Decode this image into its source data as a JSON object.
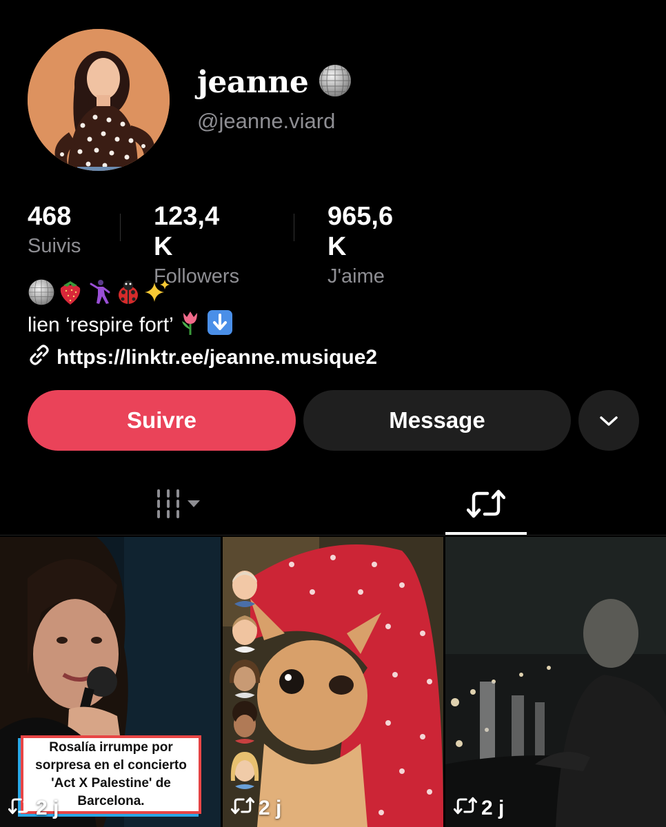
{
  "profile": {
    "display_name": "jeanne",
    "name_emoji": "disco-ball-icon",
    "handle": "@jeanne.viard"
  },
  "stats": [
    {
      "value": "468",
      "label": "Suivis"
    },
    {
      "value": "123,4 K",
      "label": "Followers"
    },
    {
      "value": "965,6 K",
      "label": "J'aime"
    }
  ],
  "bio": {
    "emojis": [
      "disco-ball-icon",
      "strawberry-icon",
      "dancer-icon",
      "ladybug-icon",
      "sparkles-icon"
    ],
    "line": "lien ‘respire fort’",
    "line_emojis": [
      "tulip-icon",
      "down-arrow-icon"
    ],
    "link": "https://linktr.ee/jeanne.musique2"
  },
  "actions": {
    "follow": "Suivre",
    "message": "Message",
    "more": "chevron-down-icon"
  },
  "tabs": [
    {
      "name": "videos",
      "icon": "grid-icon",
      "selected": false
    },
    {
      "name": "reposts",
      "icon": "repost-icon",
      "selected": true
    }
  ],
  "videos": [
    {
      "caption": "Rosalía irrumpe por sorpresa en el concierto 'Act X Palestine' de Barcelona.",
      "meta": "2 j"
    },
    {
      "caption": "",
      "meta": "2 j"
    },
    {
      "caption": "",
      "meta": "2 j"
    }
  ],
  "colors": {
    "accent": "#ea4359",
    "button_dark": "#1f1f1f",
    "muted_text": "#8e8e93",
    "background": "#000000"
  }
}
